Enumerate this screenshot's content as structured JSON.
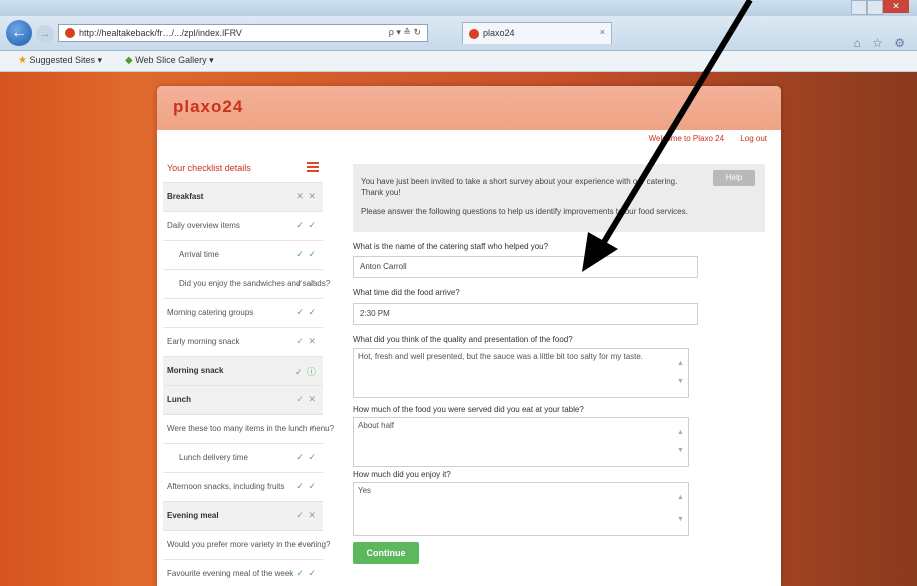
{
  "browser": {
    "url": "http://healtakeback/fr…/.../zpl/index.lFRV",
    "address_controls": "ρ ▾ ≙ ↻",
    "tab_title": "plaxo24",
    "tab_close": "×",
    "win_close": "✕",
    "icons": "⌂ ☆ ⚙",
    "favorites": [
      {
        "label": "Suggested Sites ▾"
      },
      {
        "label": "Web Slice Gallery ▾"
      }
    ]
  },
  "page": {
    "logo": "plaxo24",
    "top_links": [
      "Welcome to Plaxo 24",
      "Log out"
    ],
    "sidebar": {
      "title": "Your checklist details",
      "rows": [
        {
          "label": "Breakfast",
          "status": "✕ ✕",
          "kind": "section"
        },
        {
          "label": "Daily overview items",
          "status": "✓ ✓",
          "kind": "item"
        },
        {
          "label": "Arrival time",
          "status": "✓ ✓",
          "kind": "sub"
        },
        {
          "label": "Did you enjoy the sandwiches and salads?",
          "status": "✓ ✓",
          "kind": "sub"
        },
        {
          "label": "Morning catering groups",
          "status": "✓ ✓",
          "kind": "item"
        },
        {
          "label": "Early morning snack",
          "status": "✓ ✕",
          "kind": "item"
        },
        {
          "label": "Morning snack",
          "status": "✓ ⓘ",
          "kind": "section"
        },
        {
          "label": "Lunch",
          "status": "✓ ✕",
          "kind": "section"
        },
        {
          "label": "Were these too many items in the lunch menu?",
          "status": "✓ ✓",
          "kind": "item"
        },
        {
          "label": "Lunch delivery time",
          "status": "✓ ✓",
          "kind": "sub"
        },
        {
          "label": "Afternoon snacks, including fruits",
          "status": "✓ ✓",
          "kind": "item"
        },
        {
          "label": "Evening meal",
          "status": "✓ ✕",
          "kind": "section"
        },
        {
          "label": "Would you prefer more variety in the evening?",
          "status": "✓ ✓",
          "kind": "item"
        },
        {
          "label": "Favourite evening meal of the week",
          "status": "✓ ✓",
          "kind": "item"
        }
      ]
    },
    "intro": {
      "text1": "You have just been invited to take a short survey about your experience with our catering. Thank you!",
      "text2": "Please answer the following questions to help us identify improvements to our food services.",
      "help_label": "Help"
    },
    "questions": [
      {
        "label": "What is the name of the catering staff who helped you?",
        "value": "Anton Carroll",
        "type": "input"
      },
      {
        "label": "What time did the food arrive?",
        "value": "2:30 PM",
        "type": "input"
      },
      {
        "label": "What did you think of the quality and presentation of the food?",
        "value": "Hot, fresh and well presented, but the sauce was a little bit too salty for my taste.",
        "type": "area"
      },
      {
        "label": "How much of the food you were served did you eat at your table?",
        "value": "About half",
        "type": "area"
      },
      {
        "label": "How much did you enjoy it?",
        "value": "Yes",
        "type": "area"
      }
    ],
    "continue_label": "Continue"
  }
}
